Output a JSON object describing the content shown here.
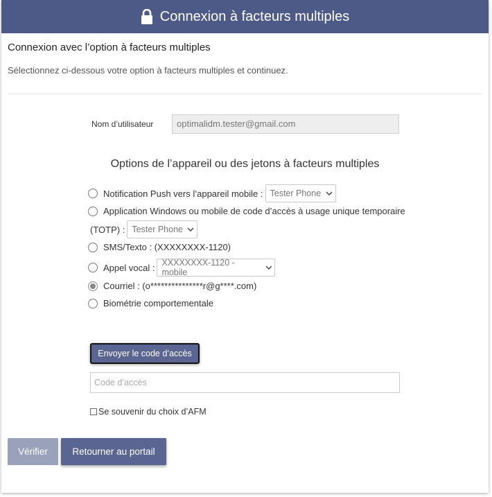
{
  "header": {
    "title": "Connexion à facteurs multiples"
  },
  "intro": {
    "subtitle": "Connexion avec l’option à facteurs multiples",
    "instruction": "Sélectionnez ci-dessous votre option à facteurs multiples et continuez."
  },
  "user": {
    "label": "Nom d’utilisateur",
    "value": "optimalidm.tester@gmail.com"
  },
  "options": {
    "title": "Options de l’appareil ou des jetons à facteurs multiples",
    "push": {
      "label": "Notification Push vers l’appareil mobile :",
      "selected": "Tester Phone",
      "checked": false
    },
    "totp": {
      "label_line1": "Application Windows ou mobile de code d’accès à usage unique temporaire",
      "label_line2": "(TOTP) :",
      "selected": "Tester Phone",
      "checked": false
    },
    "sms": {
      "label": "SMS/Texto : (XXXXXXXX-1120)",
      "checked": false
    },
    "voice": {
      "label": "Appel vocal :",
      "selected": "XXXXXXXX-1120 - mobile",
      "checked": false
    },
    "email": {
      "label": "Courriel : (o***************r@g****.com)",
      "checked": true
    },
    "bio": {
      "label": "Biométrie comportementale",
      "checked": false
    }
  },
  "send_button": "Envoyer le code d’accès",
  "code_input": {
    "placeholder": "Code d’accès",
    "value": ""
  },
  "remember": {
    "label": "Se souvenir du choix d’AFM",
    "checked": false
  },
  "actions": {
    "verify": "Vérifier",
    "portal": "Retourner au portail"
  },
  "colors": {
    "brand": "#4d5a87",
    "button": "#5b6591",
    "disabled": "#9aa1bb"
  }
}
